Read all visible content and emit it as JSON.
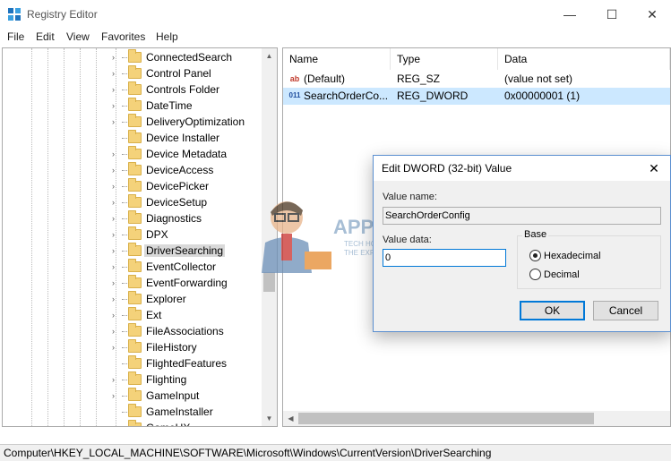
{
  "window": {
    "title": "Registry Editor",
    "minimize": "—",
    "maximize": "☐",
    "close": "✕"
  },
  "menu": [
    "File",
    "Edit",
    "View",
    "Favorites",
    "Help"
  ],
  "tree": {
    "items": [
      {
        "label": "ConnectedSearch",
        "expander": "›"
      },
      {
        "label": "Control Panel",
        "expander": "›"
      },
      {
        "label": "Controls Folder",
        "expander": "›"
      },
      {
        "label": "DateTime",
        "expander": "›"
      },
      {
        "label": "DeliveryOptimization",
        "expander": "›"
      },
      {
        "label": "Device Installer",
        "expander": ""
      },
      {
        "label": "Device Metadata",
        "expander": "›"
      },
      {
        "label": "DeviceAccess",
        "expander": "›"
      },
      {
        "label": "DevicePicker",
        "expander": "›"
      },
      {
        "label": "DeviceSetup",
        "expander": "›"
      },
      {
        "label": "Diagnostics",
        "expander": "›"
      },
      {
        "label": "DPX",
        "expander": "›"
      },
      {
        "label": "DriverSearching",
        "expander": "›",
        "selected": true
      },
      {
        "label": "EventCollector",
        "expander": "›"
      },
      {
        "label": "EventForwarding",
        "expander": "›"
      },
      {
        "label": "Explorer",
        "expander": "›"
      },
      {
        "label": "Ext",
        "expander": "›"
      },
      {
        "label": "FileAssociations",
        "expander": "›"
      },
      {
        "label": "FileHistory",
        "expander": "›"
      },
      {
        "label": "FlightedFeatures",
        "expander": ""
      },
      {
        "label": "Flighting",
        "expander": "›"
      },
      {
        "label": "GameInput",
        "expander": "›"
      },
      {
        "label": "GameInstaller",
        "expander": ""
      },
      {
        "label": "GameUX",
        "expander": "›"
      }
    ]
  },
  "list": {
    "headers": [
      "Name",
      "Type",
      "Data"
    ],
    "rows": [
      {
        "icon": "ab",
        "name": "(Default)",
        "type": "REG_SZ",
        "data": "(value not set)",
        "selected": false
      },
      {
        "icon": "011",
        "name": "SearchOrderCo...",
        "type": "REG_DWORD",
        "data": "0x00000001 (1)",
        "selected": true
      }
    ]
  },
  "statusbar": {
    "path": "Computer\\HKEY_LOCAL_MACHINE\\SOFTWARE\\Microsoft\\Windows\\CurrentVersion\\DriverSearching"
  },
  "dialog": {
    "title": "Edit DWORD (32-bit) Value",
    "close": "✕",
    "value_name_label": "Value name:",
    "value_name": "SearchOrderConfig",
    "value_data_label": "Value data:",
    "value_data": "0",
    "base_label": "Base",
    "radio_hex": "Hexadecimal",
    "radio_dec": "Decimal",
    "ok": "OK",
    "cancel": "Cancel"
  },
  "watermark": {
    "brand": "APPUALS",
    "tagline_1": "TECH HOW-TO'S FROM",
    "tagline_2": "THE EXPERTS!"
  },
  "colors": {
    "selection": "#cce8ff",
    "accent": "#0078d7",
    "tree_selected": "#d9d9d9"
  }
}
